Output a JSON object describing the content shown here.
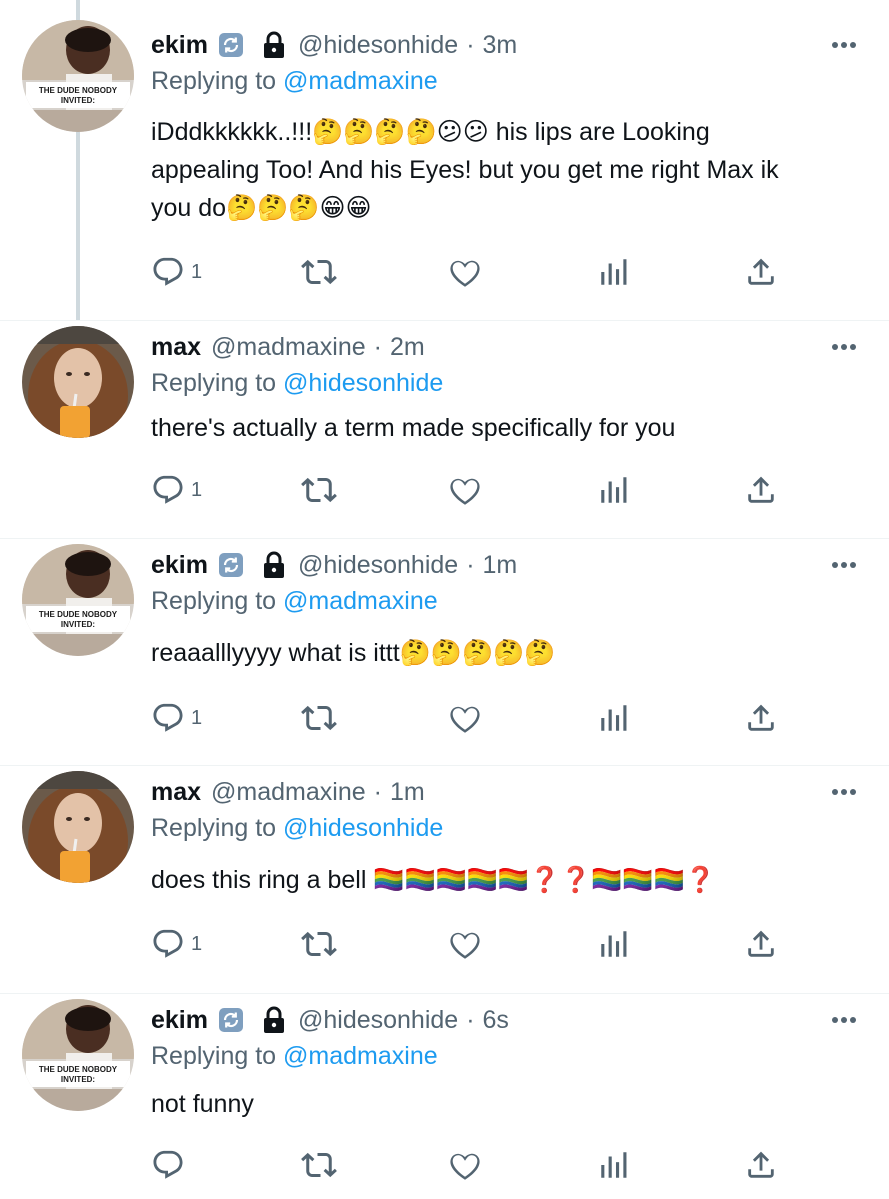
{
  "thread": {
    "tweets": [
      {
        "name": "ekim",
        "handle": "@hidesonhide",
        "separator": "·",
        "time": "3m",
        "avatar_caption": "THE DUDE NOBODY INVITED:",
        "replying_prefix": "Replying to",
        "replying_to": "@madmaxine",
        "text": "iDddkkkkkk..!!!🤔🤔🤔🤔😕😕 his lips are Looking appealing Too! And his Eyes! but you get me right Max ik you do🤔🤔🤔😁😁",
        "reply_count": "1",
        "verified_style_icon": "sync-badge-icon",
        "protected": true
      },
      {
        "name": "max",
        "handle": "@madmaxine",
        "separator": "·",
        "time": "2m",
        "replying_prefix": "Replying to",
        "replying_to": "@hidesonhide",
        "text": "there's actually a term made specifically for you",
        "reply_count": "1"
      },
      {
        "name": "ekim",
        "handle": "@hidesonhide",
        "separator": "·",
        "time": "1m",
        "avatar_caption": "THE DUDE NOBODY INVITED:",
        "replying_prefix": "Replying to",
        "replying_to": "@madmaxine",
        "text": "reaaalllyyyy what is ittt🤔🤔🤔🤔🤔",
        "reply_count": "1",
        "verified_style_icon": "sync-badge-icon",
        "protected": true
      },
      {
        "name": "max",
        "handle": "@madmaxine",
        "separator": "·",
        "time": "1m",
        "replying_prefix": "Replying to",
        "replying_to": "@hidesonhide",
        "text": "does this ring a bell 🏳️‍🌈🏳️‍🌈🏳️‍🌈🏳️‍🌈🏳️‍🌈❓❓🏳️‍🌈🏳️‍🌈🏳️‍🌈❓",
        "reply_count": "1"
      },
      {
        "name": "ekim",
        "handle": "@hidesonhide",
        "separator": "·",
        "time": "6s",
        "avatar_caption": "THE DUDE NOBODY INVITED:",
        "replying_prefix": "Replying to",
        "replying_to": "@madmaxine",
        "text": "not funny",
        "reply_count": "",
        "verified_style_icon": "sync-badge-icon",
        "protected": true
      }
    ]
  },
  "icons": {
    "reply": "reply-icon",
    "retweet": "retweet-icon",
    "like": "heart-icon",
    "analytics": "analytics-icon",
    "share": "share-icon",
    "more": "more-dots-icon",
    "lock": "lock-icon"
  },
  "colors": {
    "text": "#0f1419",
    "secondary": "#536471",
    "link": "#1d9bf0",
    "icon": "#536471",
    "thread_line": "#cfd9de",
    "badge": "#7f9fbf"
  }
}
